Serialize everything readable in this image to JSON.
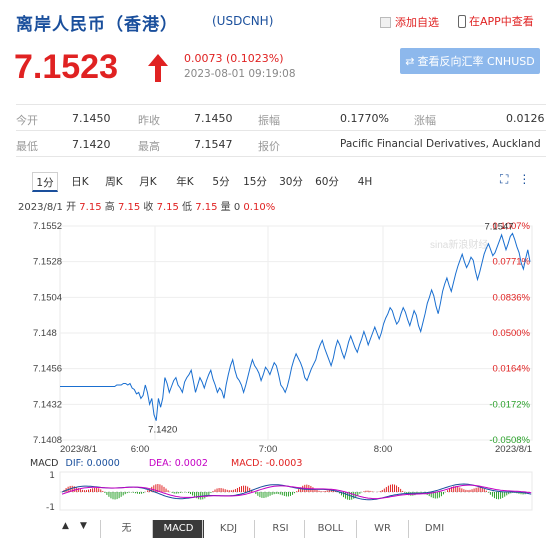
{
  "header": {
    "title": "离岸人民币（香港）",
    "code": "(USDCNH)",
    "add_watch": "添加自选",
    "app_open": "在APP中查看"
  },
  "quote": {
    "price": "7.1523",
    "change": "0.0073 (0.1023%)",
    "time": "2023-08-01 09:19:08",
    "reverse_button": "查看反向汇率 CNHUSD",
    "color_up": "#e02222"
  },
  "stats": {
    "row1": [
      {
        "label": "今开",
        "value": "7.1450"
      },
      {
        "label": "昨收",
        "value": "7.1450"
      },
      {
        "label": "振幅",
        "value": "0.1770%"
      },
      {
        "label": "涨幅",
        "value": "0.0126"
      }
    ],
    "row2": [
      {
        "label": "最低",
        "value": "7.1420"
      },
      {
        "label": "最高",
        "value": "7.1547"
      },
      {
        "label": "报价",
        "value": "Pacific Financial Derivatives, Auckland"
      }
    ]
  },
  "tabs": [
    "1分",
    "日K",
    "周K",
    "月K",
    "年K",
    "5分",
    "15分",
    "30分",
    "60分",
    "4H"
  ],
  "active_tab": "1分",
  "info_line": {
    "date": "2023/8/1",
    "open_label": "开",
    "open": "7.15",
    "high_label": "高",
    "high": "7.15",
    "close_label": "收",
    "close": "7.15",
    "low_label": "低",
    "low": "7.15",
    "vol_label": "量",
    "vol": "0",
    "pct": "0.10%"
  },
  "chart_data": {
    "type": "line",
    "y_ticks_left": [
      "7.1552",
      "7.1528",
      "7.1504",
      "7.148",
      "7.1456",
      "7.1432",
      "7.1408"
    ],
    "y_ticks_right": [
      "0.1007%",
      "0.0771%",
      "0.0836%",
      "0.0500%",
      "0.0164%",
      "-0.0172%",
      "-0.0508%"
    ],
    "x_ticks": [
      "2023/8/1",
      "6:00",
      "7:00",
      "8:00",
      "2023/8/1"
    ],
    "ylim": [
      7.1408,
      7.1552
    ],
    "annotations": {
      "low": "7.1420",
      "high": "7.1547"
    },
    "watermark": "sina新浪财经",
    "series": [
      {
        "values": [
          7.1444,
          7.1444,
          7.1444,
          7.1444,
          7.1444,
          7.1444,
          7.1444,
          7.1444,
          7.1444,
          7.1444,
          7.1444,
          7.1444,
          7.1444,
          7.1444,
          7.1444,
          7.1444,
          7.1444,
          7.1444,
          7.1444,
          7.1444,
          7.1444,
          7.1444,
          7.1444,
          7.1444,
          7.1444,
          7.1444,
          7.1445,
          7.1445,
          7.1445,
          7.1446,
          7.1446,
          7.1445,
          7.1446,
          7.1443,
          7.1442,
          7.1439,
          7.144,
          7.1436,
          7.1438,
          7.1445,
          7.144,
          7.1432,
          7.1436,
          7.1425,
          7.1421,
          7.1436,
          7.143,
          7.1436,
          7.145,
          7.1446,
          7.144,
          7.1444,
          7.1448,
          7.145,
          7.1445,
          7.1443,
          7.144,
          7.1447,
          7.145,
          7.1452,
          7.1455,
          7.1448,
          7.144,
          7.1445,
          7.145,
          7.1447,
          7.1443,
          7.1448,
          7.1452,
          7.1455,
          7.1449,
          7.1445,
          7.144,
          7.1443,
          7.1441,
          7.1436,
          7.1445,
          7.1452,
          7.1458,
          7.1462,
          7.1455,
          7.145,
          7.1448,
          7.1445,
          7.144,
          7.1445,
          7.1451,
          7.1457,
          7.1462,
          7.1458,
          7.1456,
          7.1453,
          7.1448,
          7.1452,
          7.1457,
          7.1455,
          7.1452,
          7.1456,
          7.146,
          7.1458,
          7.1452,
          7.1445,
          7.1443,
          7.144,
          7.1444,
          7.145,
          7.1457,
          7.1462,
          7.1466,
          7.1463,
          7.146,
          7.1456,
          7.145,
          7.1448,
          7.1452,
          7.1456,
          7.1459,
          7.1462,
          7.1468,
          7.1472,
          7.1475,
          7.147,
          7.1466,
          7.1462,
          7.1458,
          7.1463,
          7.147,
          7.1475,
          7.1472,
          7.1467,
          7.1463,
          7.1468,
          7.1474,
          7.1478,
          7.1474,
          7.147,
          7.1467,
          7.1472,
          7.1476,
          7.1481,
          7.1477,
          7.1472,
          7.1476,
          7.148,
          7.1484,
          7.148,
          7.1476,
          7.148,
          7.1486,
          7.149,
          7.1493,
          7.1497,
          7.1495,
          7.149,
          7.1486,
          7.1488,
          7.1493,
          7.1497,
          7.1494,
          7.1489,
          7.1485,
          7.149,
          7.1495,
          7.1492,
          7.1485,
          7.1481,
          7.1487,
          7.1493,
          7.15,
          7.1504,
          7.1509,
          7.1505,
          7.1498,
          7.1493,
          7.15,
          7.1508,
          7.1513,
          7.1517,
          7.1512,
          7.1508,
          7.1514,
          7.152,
          7.1525,
          7.1529,
          7.1533,
          7.1528,
          7.1524,
          7.1527,
          7.1531,
          7.1529,
          7.1522,
          7.1516,
          7.1521,
          7.1527,
          7.1533,
          7.1537,
          7.154,
          7.1536,
          7.1532,
          7.1534,
          7.1538,
          7.1542,
          7.1546,
          7.1541,
          7.1536,
          7.154,
          7.1545,
          7.1547,
          7.1543,
          7.1538,
          7.1534,
          7.1527,
          7.1523,
          7.153,
          7.1536,
          7.1528
        ]
      }
    ]
  },
  "macd": {
    "label": "MACD",
    "dif": "DIF: 0.0000",
    "dea": "DEA: 0.0002",
    "macd": "MACD: -0.0003",
    "tick_top": "1",
    "tick_bottom": "-1",
    "color_dif": "#1a4f9c",
    "color_dea": "#c400c4",
    "color_macd": "#e02222"
  },
  "bottom_tabs": [
    "无",
    "MACD",
    "KDJ",
    "RSI",
    "BOLL",
    "WR",
    "DMI"
  ],
  "bottom_active": "MACD",
  "bottom_arrows": {
    "up": "▲",
    "down": "▼"
  }
}
